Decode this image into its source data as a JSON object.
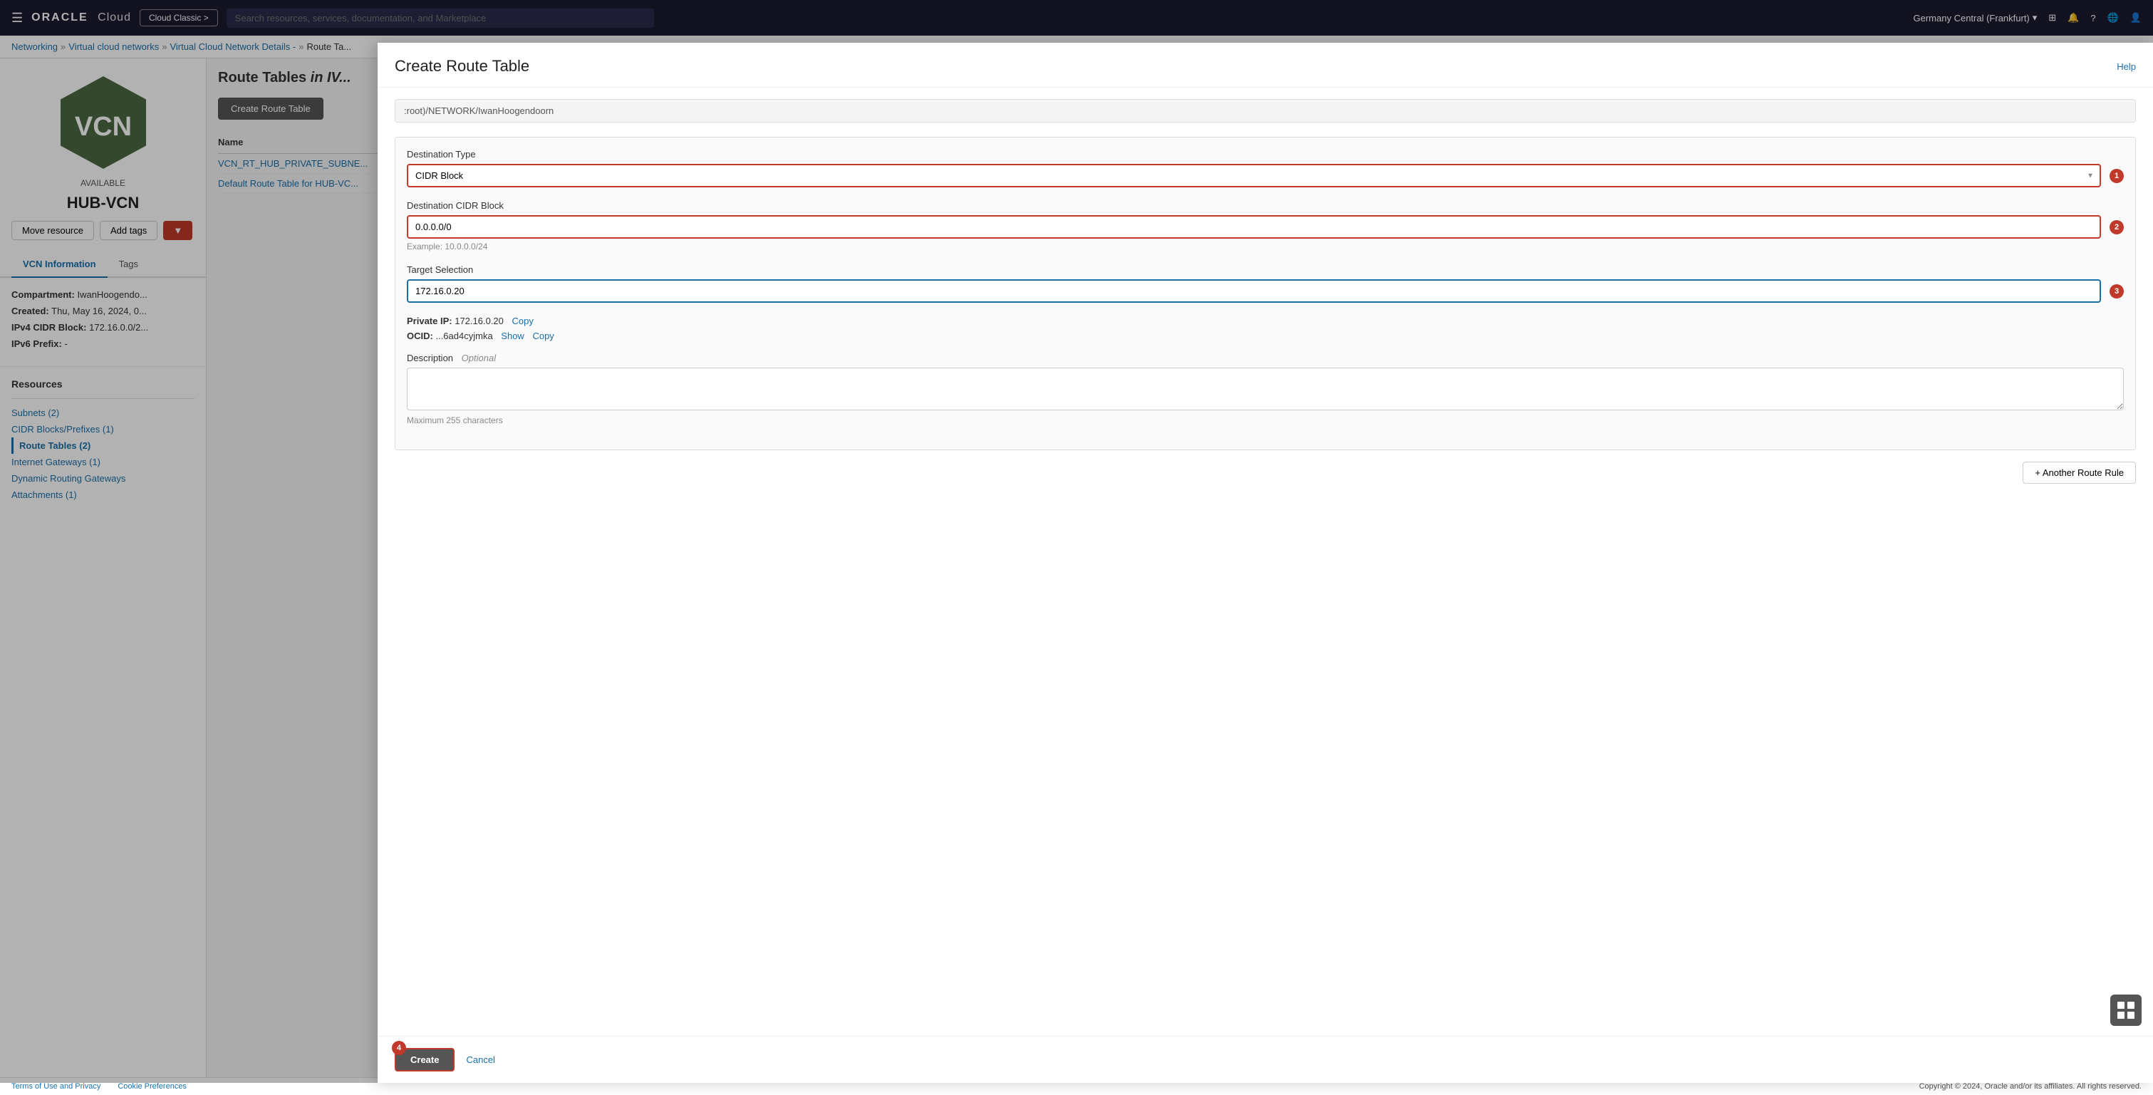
{
  "topnav": {
    "hamburger_label": "☰",
    "oracle_label": "ORACLE",
    "cloud_label": "Cloud",
    "cloud_classic_label": "Cloud Classic >",
    "search_placeholder": "Search resources, services, documentation, and Marketplace",
    "region_label": "Germany Central (Frankfurt)",
    "region_arrow": "▾"
  },
  "breadcrumb": {
    "networking": "Networking",
    "vcn_list": "Virtual cloud networks",
    "vcn_detail": "Virtual Cloud Network Details -",
    "route_tables": "Route Ta..."
  },
  "sidebar": {
    "vcn_name": "HUB-VCN",
    "vcn_status": "AVAILABLE",
    "vcn_logo_text": "VCN",
    "move_resource": "Move resource",
    "add_tags": "Add tags",
    "terminate_btn": "■",
    "tabs": [
      {
        "label": "VCN Information",
        "active": true
      },
      {
        "label": "Tags",
        "active": false
      }
    ],
    "compartment_label": "Compartment:",
    "compartment_value": "IwanHoogendo...",
    "created_label": "Created:",
    "created_value": "Thu, May 16, 2024, 0...",
    "ipv4_label": "IPv4 CIDR Block:",
    "ipv4_value": "172.16.0.0/2...",
    "ipv6_label": "IPv6 Prefix:",
    "ipv6_value": "-"
  },
  "resources": {
    "title": "Resources",
    "items": [
      {
        "label": "Subnets (2)",
        "active": false
      },
      {
        "label": "CIDR Blocks/Prefixes (1)",
        "active": false
      },
      {
        "label": "Route Tables (2)",
        "active": true
      },
      {
        "label": "Internet Gateways (1)",
        "active": false
      },
      {
        "label": "Dynamic Routing Gateways",
        "active": false
      },
      {
        "label": "Attachments (1)",
        "active": false
      }
    ]
  },
  "route_tables": {
    "title": "Route Tables",
    "subtitle": "in IV...",
    "create_btn": "Create Route Table",
    "name_col": "Name",
    "rows": [
      {
        "name": "VCN_RT_HUB_PRIVATE_SUBNE..."
      },
      {
        "name": "Default Route Table for HUB-VC..."
      }
    ]
  },
  "dialog": {
    "title": "Create Route Table",
    "help_label": "Help",
    "compartment_path": ":root)/NETWORK/IwanHoogendoorn",
    "destination_type_label": "Destination Type",
    "destination_type_value": "CIDR Block",
    "destination_type_badge": "1",
    "destination_cidr_label": "Destination CIDR Block",
    "destination_cidr_value": "0.0.0.0/0",
    "destination_cidr_badge": "2",
    "destination_cidr_example": "Example: 10.0.0.0/24",
    "target_selection_label": "Target Selection",
    "target_selection_value": "172.16.0.20",
    "target_selection_badge": "3",
    "private_ip_label": "Private IP:",
    "private_ip_value": "172.16.0.20",
    "copy_label": "Copy",
    "ocid_label": "OCID:",
    "ocid_value": "...6ad4cyjmka",
    "show_label": "Show",
    "description_label": "Description",
    "description_optional": "Optional",
    "description_value": "",
    "description_placeholder": "",
    "max_chars": "Maximum 255 characters",
    "another_rule_btn": "+ Another Route Rule",
    "create_btn": "Create",
    "cancel_label": "Cancel",
    "create_badge": "4"
  }
}
